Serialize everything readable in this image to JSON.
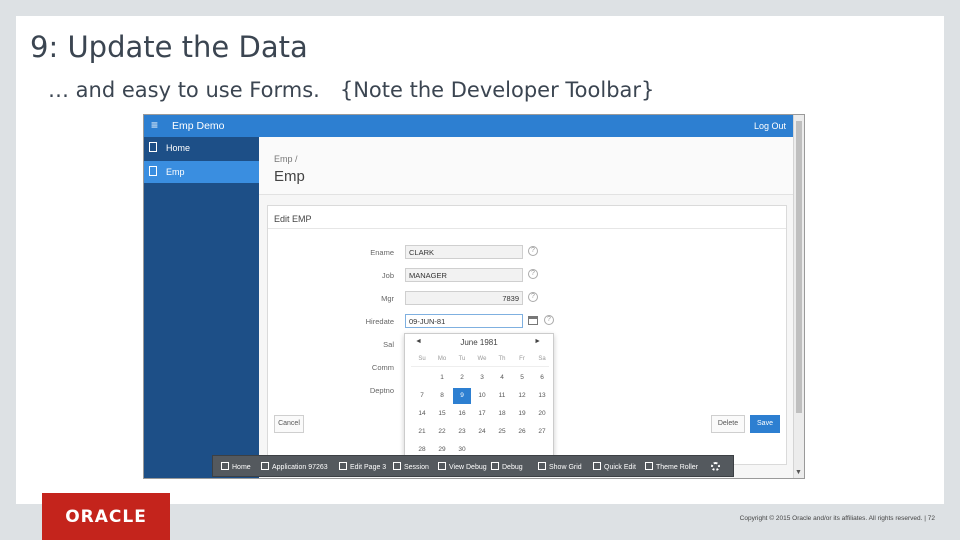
{
  "slide": {
    "title": "9: Update the Data",
    "subtitle": "… and easy to use Forms.   {Note the Developer Toolbar}",
    "copyright": "Copyright © 2015 Oracle and/or its affiliates. All rights reserved.  |  72"
  },
  "logo": {
    "text": "ORACLE"
  },
  "app": {
    "menu_icon": "≡",
    "name": "Emp Demo",
    "logout": "Log Out",
    "nav": [
      {
        "label": "Home"
      },
      {
        "label": "Emp"
      }
    ],
    "breadcrumb": "Emp  /",
    "page_title": "Emp",
    "region_title": "Edit EMP",
    "fields": [
      {
        "label": "Ename",
        "value": "CLARK"
      },
      {
        "label": "Job",
        "value": "MANAGER"
      },
      {
        "label": "Mgr",
        "value": "7839"
      },
      {
        "label": "Hiredate",
        "value": "09-JUN-81"
      },
      {
        "label": "Sal",
        "value": ""
      },
      {
        "label": "Comm",
        "value": ""
      },
      {
        "label": "Deptno",
        "value": ""
      }
    ],
    "calendar": {
      "prev": "◄",
      "next": "►",
      "month": "June 1981",
      "weekdays": [
        "Su",
        "Mo",
        "Tu",
        "We",
        "Th",
        "Fr",
        "Sa"
      ],
      "weeks": [
        [
          "",
          "1",
          "2",
          "3",
          "4",
          "5",
          "6"
        ],
        [
          "7",
          "8",
          "9",
          "10",
          "11",
          "12",
          "13"
        ],
        [
          "14",
          "15",
          "16",
          "17",
          "18",
          "19",
          "20"
        ],
        [
          "21",
          "22",
          "23",
          "24",
          "25",
          "26",
          "27"
        ],
        [
          "28",
          "29",
          "30",
          "",
          "",
          "",
          ""
        ]
      ],
      "selected": "9"
    },
    "buttons": {
      "cancel": "Cancel",
      "delete": "Delete",
      "save": "Save"
    },
    "help_glyph": "?",
    "dev_toolbar": [
      {
        "label": "Home",
        "icon": "home-icon"
      },
      {
        "label": "Application 97263",
        "icon": "application-icon"
      },
      {
        "label": "Edit Page 3",
        "icon": "edit-page-icon"
      },
      {
        "label": "Session",
        "icon": "session-icon"
      },
      {
        "label": "View Debug",
        "icon": "view-debug-icon"
      },
      {
        "label": "Debug",
        "icon": "debug-icon"
      },
      {
        "label": "Show Grid",
        "icon": "grid-icon"
      },
      {
        "label": "Quick Edit",
        "icon": "quick-edit-icon"
      },
      {
        "label": "Theme Roller",
        "icon": "theme-roller-icon"
      },
      {
        "label": "",
        "icon": "gear-icon"
      }
    ],
    "colors": {
      "header": "#2d7fd1",
      "sidebar": "#1d4f87",
      "toolbar": "#54595e",
      "brand": "#c4241c"
    }
  }
}
